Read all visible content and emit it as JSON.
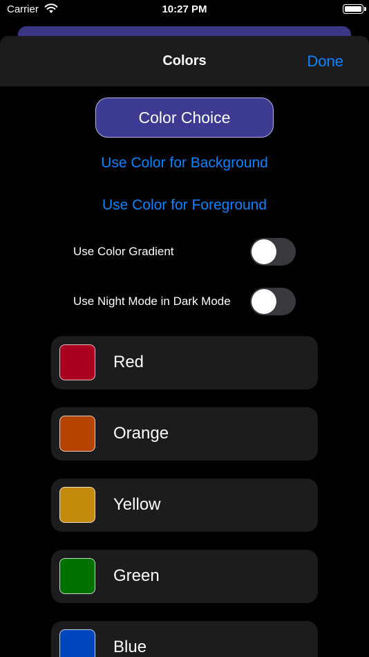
{
  "status_bar": {
    "carrier": "Carrier",
    "time": "10:27 PM"
  },
  "nav": {
    "title": "Colors",
    "done_label": "Done"
  },
  "color_choice_label": "Color Choice",
  "links": {
    "background": "Use Color for Background",
    "foreground": "Use Color for Foreground"
  },
  "toggles": [
    {
      "label": "Use Color Gradient",
      "on": false
    },
    {
      "label": "Use Night Mode in Dark Mode",
      "on": false
    }
  ],
  "colors": [
    {
      "name": "Red",
      "hex": "#a8001e"
    },
    {
      "name": "Orange",
      "hex": "#b54300"
    },
    {
      "name": "Yellow",
      "hex": "#c38a0b"
    },
    {
      "name": "Green",
      "hex": "#007200"
    },
    {
      "name": "Blue",
      "hex": "#0047be"
    }
  ],
  "accent": "#0a84ff"
}
